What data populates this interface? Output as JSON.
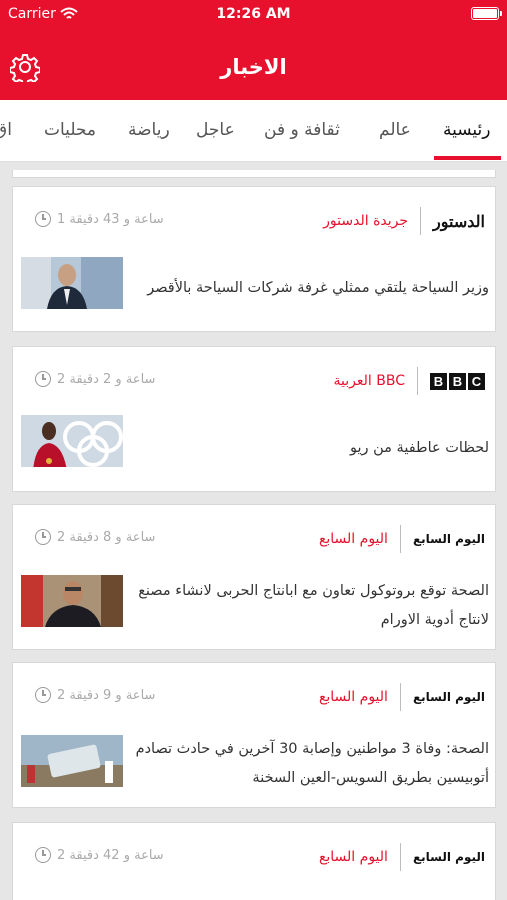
{
  "status_bar": {
    "carrier": "Carrier",
    "time": "12:26 AM"
  },
  "app": {
    "title": "الاخبار",
    "accent": "#e8112d"
  },
  "tabs": [
    "رئيسية",
    "عالم",
    "ثقافة و فن",
    "عاجل",
    "رياضة",
    "محليات",
    "اق"
  ],
  "articles": [
    {
      "source": "جريدة الدستور",
      "logo_text": "الدستور",
      "time": "1 ساعة و 43 دقيقة",
      "headline": "وزير السياحة يلتقي ممثلي غرفة شركات السياحة بالأقصر"
    },
    {
      "source": "العربية BBC",
      "logo_text": "BBC",
      "time": "2 ساعة و 2 دقيقة",
      "headline": "لحظات عاطفية من ريو"
    },
    {
      "source": "اليوم السابع",
      "logo_text": "اليوم السابع",
      "time": "2 ساعة و 8 دقيقة",
      "headline": "الصحة توقع بروتوكول تعاون مع ابانتاج الحربى لانشاء مصنع لانتاج أدوية الاورام"
    },
    {
      "source": "اليوم السابع",
      "logo_text": "اليوم السابع",
      "time": "2 ساعة و 9 دقيقة",
      "headline": "الصحة: وفاة 3 مواطنين وإصابة 30 آخرين في حادث تصادم أتوبيسين بطريق السويس-العين السخنة"
    },
    {
      "source": "اليوم السابع",
      "logo_text": "اليوم السابع",
      "time": "2 ساعة و 42 دقيقة"
    }
  ]
}
